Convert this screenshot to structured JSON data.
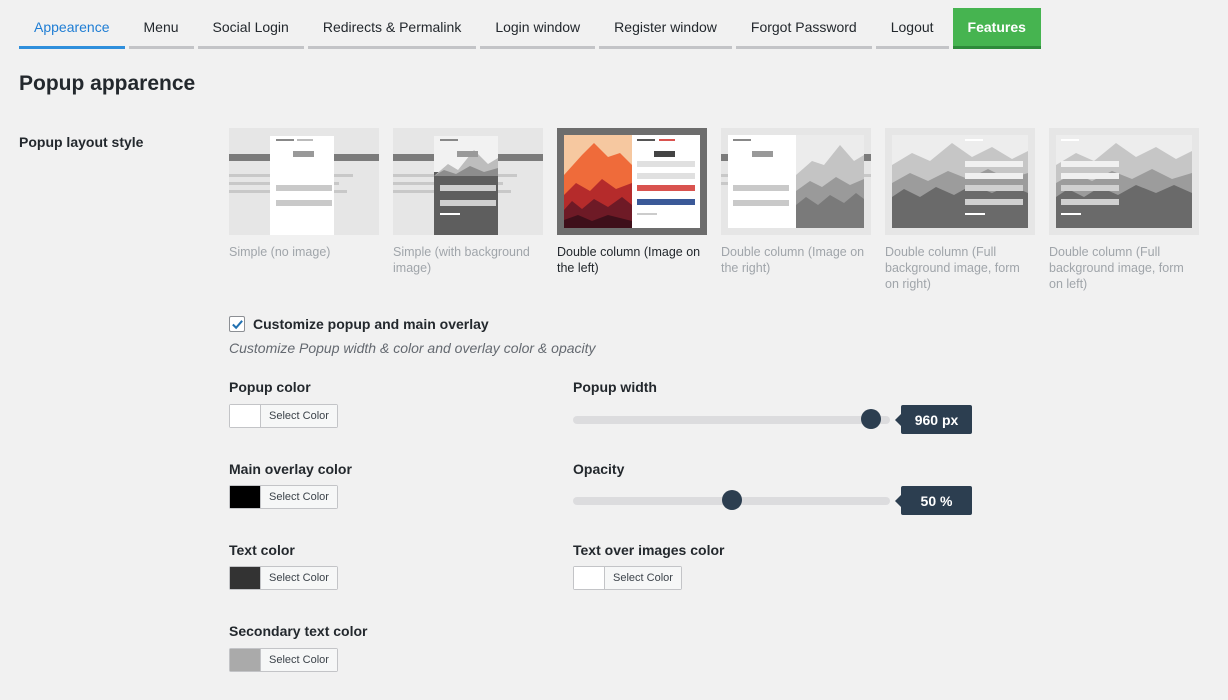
{
  "tabs": [
    {
      "label": "Appearence"
    },
    {
      "label": "Menu"
    },
    {
      "label": "Social Login"
    },
    {
      "label": "Redirects & Permalink"
    },
    {
      "label": "Login window"
    },
    {
      "label": "Register window"
    },
    {
      "label": "Forgot Password"
    },
    {
      "label": "Logout"
    },
    {
      "label": "Features"
    }
  ],
  "section_title": "Popup apparence",
  "layout_label": "Popup layout style",
  "layouts": [
    {
      "caption": "Simple (no image)"
    },
    {
      "caption": "Simple (with background image)"
    },
    {
      "caption": "Double column (Image on the left)"
    },
    {
      "caption": "Double column (Image on the right)"
    },
    {
      "caption": "Double column (Full background image, form on right)"
    },
    {
      "caption": "Double column (Full background image, form on left)"
    }
  ],
  "selected_layout": "Double column (Image on the left)",
  "customize": {
    "checked": true,
    "label": "Customize popup and main overlay",
    "description": "Customize Popup width & color and overlay color & opacity"
  },
  "colors": {
    "popup": {
      "label": "Popup color",
      "button": "Select Color",
      "value": "#ffffff"
    },
    "overlay": {
      "label": "Main overlay color",
      "button": "Select Color",
      "value": "#000000"
    },
    "text": {
      "label": "Text color",
      "button": "Select Color",
      "value": "#333333"
    },
    "secondary": {
      "label": "Secondary text color",
      "button": "Select Color",
      "value": "#aaaaaa"
    },
    "text_over_images": {
      "label": "Text over images color",
      "button": "Select Color",
      "value": "#ffffff"
    }
  },
  "popup_width": {
    "label": "Popup width",
    "value_text": "960 px",
    "fraction": 0.97
  },
  "opacity": {
    "label": "Opacity",
    "value_text": "50 %",
    "fraction": 0.5
  },
  "accent_colors": {
    "active_tab": "#1e7dd4",
    "features_tab": "#46b450",
    "slider_knob": "#2c3e50"
  }
}
